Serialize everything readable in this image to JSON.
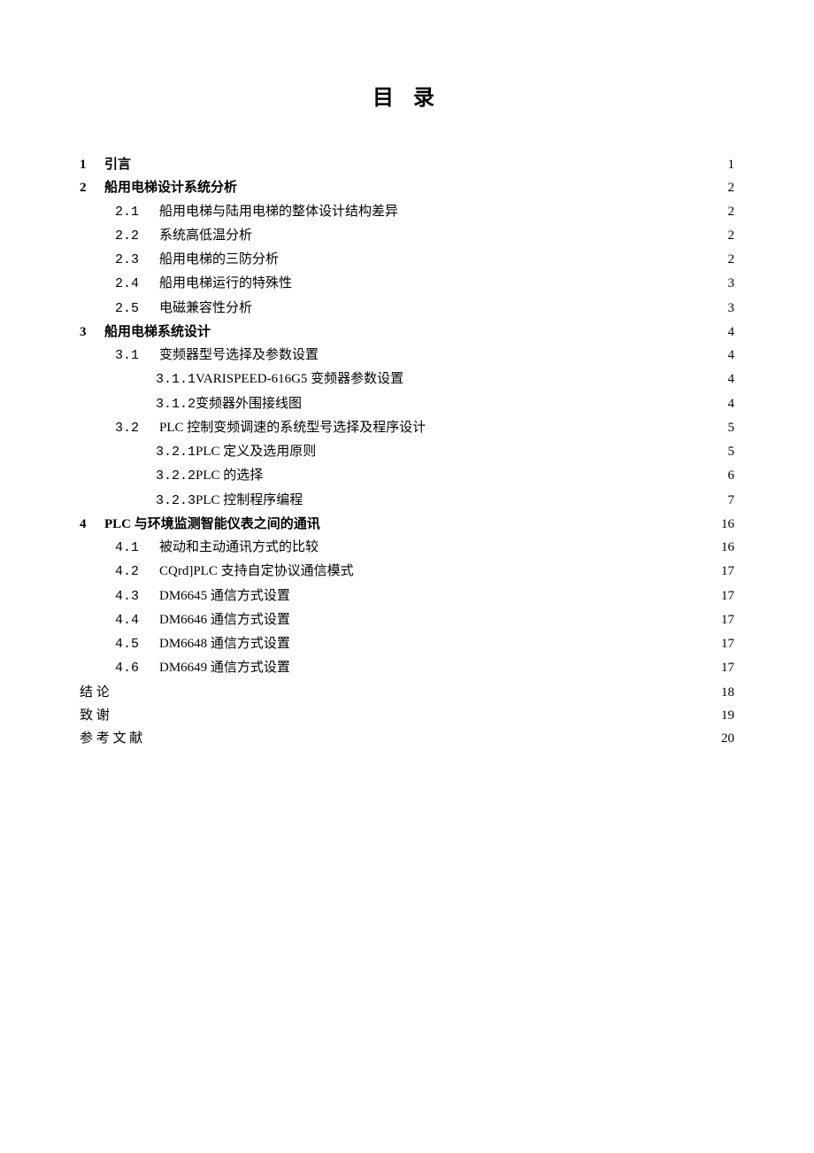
{
  "title": "目 录",
  "entries": [
    {
      "level": 0,
      "num": "1",
      "label": "引言",
      "page": "1",
      "bold": true
    },
    {
      "level": 0,
      "num": "2",
      "label": "船用电梯设计系统分析",
      "page": "2",
      "bold": true
    },
    {
      "level": 1,
      "num": "2.1",
      "label": "船用电梯与陆用电梯的整体设计结构差异",
      "page": "2"
    },
    {
      "level": 1,
      "num": "2.2",
      "label": "系统高低温分析",
      "page": "2"
    },
    {
      "level": 1,
      "num": "2.3",
      "label": "船用电梯的三防分析",
      "page": "2"
    },
    {
      "level": 1,
      "num": "2.4",
      "label": "船用电梯运行的特殊性",
      "page": "3"
    },
    {
      "level": 1,
      "num": "2.5",
      "label": "电磁兼容性分析",
      "page": "3"
    },
    {
      "level": 0,
      "num": "3",
      "label": "船用电梯系统设计",
      "page": "4",
      "bold": true
    },
    {
      "level": 1,
      "num": "3.1",
      "label": "变频器型号选择及参数设置",
      "page": "4"
    },
    {
      "level": 2,
      "num": "3.1.1",
      "label": " VARISPEED-616G5 变频器参数设置",
      "page": "4"
    },
    {
      "level": 2,
      "num": "3.1.2",
      "label": " 变频器外围接线图",
      "page": "4"
    },
    {
      "level": 1,
      "num": "3.2",
      "label": "PLC 控制变频调速的系统型号选择及程序设计",
      "page": "5"
    },
    {
      "level": 2,
      "num": "3.2.1",
      "label": " PLC 定义及选用原则",
      "page": "5"
    },
    {
      "level": 2,
      "num": "3.2.2",
      "label": " PLC 的选择",
      "page": "6"
    },
    {
      "level": 2,
      "num": "3.2.3",
      "label": " PLC 控制程序编程",
      "page": "7"
    },
    {
      "level": 0,
      "num": "4",
      "label": "PLC 与环境监测智能仪表之间的通讯",
      "page": "16",
      "bold": true
    },
    {
      "level": 1,
      "num": "4.1",
      "label": "被动和主动通讯方式的比较",
      "page": "16"
    },
    {
      "level": 1,
      "num": "4.2",
      "label": "CQrd]PLC 支持自定协议通信模式",
      "page": "17"
    },
    {
      "level": 1,
      "num": "4.3",
      "label": "DM6645 通信方式设置",
      "page": "17"
    },
    {
      "level": 1,
      "num": "4.4",
      "label": "DM6646 通信方式设置",
      "page": "17"
    },
    {
      "level": 1,
      "num": "4.5",
      "label": "DM6648 通信方式设置",
      "page": "17"
    },
    {
      "level": 1,
      "num": "4.6",
      "label": "DM6649 通信方式设置",
      "page": "17"
    },
    {
      "level": 0,
      "num": "",
      "label": "结   论",
      "page": "18",
      "bold": false
    },
    {
      "level": 0,
      "num": "",
      "label": "致   谢",
      "page": "19",
      "bold": false
    },
    {
      "level": 0,
      "num": "",
      "label": "参 考 文 献",
      "page": "20",
      "bold": false
    }
  ]
}
